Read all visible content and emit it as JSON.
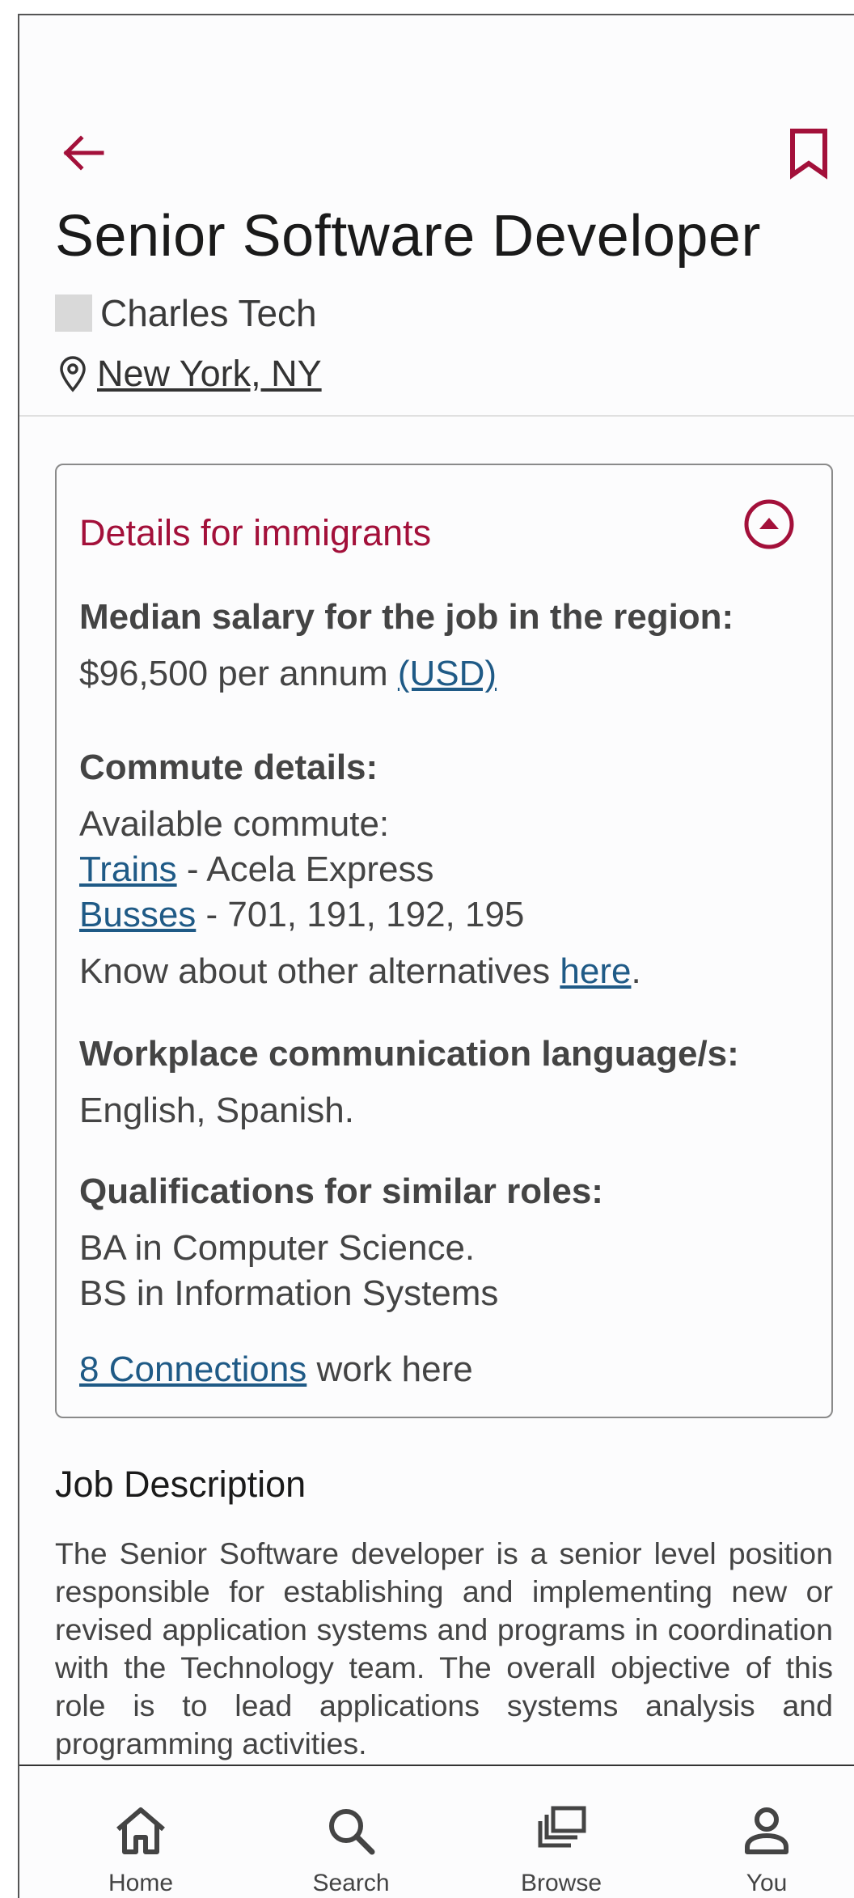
{
  "header": {
    "back_icon": "arrow-left-icon",
    "bookmark_icon": "bookmark-icon",
    "accent_color": "#a3103a"
  },
  "job": {
    "title": "Senior Software Developer",
    "company": "Charles Tech",
    "location": "New York, NY"
  },
  "details": {
    "title": "Details for immigrants",
    "collapse_icon": "chevron-up-circle-icon",
    "salary_heading": "Median salary for the job in the region:",
    "salary_value": "$96,500 per annum",
    "salary_currency": "(USD)",
    "commute_heading": "Commute details:",
    "commute_available": "Available commute:",
    "trains_label": "Trains",
    "trains_value": " - Acela Express",
    "busses_label": "Busses",
    "busses_value": " - 701, 191, 192, 195",
    "alternatives_prefix": "Know about other alternatives ",
    "alternatives_link": "here",
    "alternatives_suffix": ".",
    "language_heading": "Workplace communication language/s:",
    "language_value": "English, Spanish.",
    "qualifications_heading": "Qualifications for similar roles:",
    "qualification_1": "BA in Computer Science.",
    "qualification_2": "BS in Information Systems",
    "connections_link": "8 Connections",
    "connections_suffix": " work here",
    "link_color": "#1f5a86"
  },
  "description": {
    "title": "Job Description",
    "text": "The Senior Software developer is a senior level position responsible for establishing and implementing new or revised application systems and programs in coordination with the Technology team. The overall objective of this role is to lead applications systems analysis and programming activities."
  },
  "bottom_nav": {
    "items": [
      {
        "label": "Home",
        "icon": "home-icon"
      },
      {
        "label": "Search",
        "icon": "search-icon"
      },
      {
        "label": "Browse",
        "icon": "browse-icon"
      },
      {
        "label": "You",
        "icon": "person-icon"
      }
    ]
  }
}
